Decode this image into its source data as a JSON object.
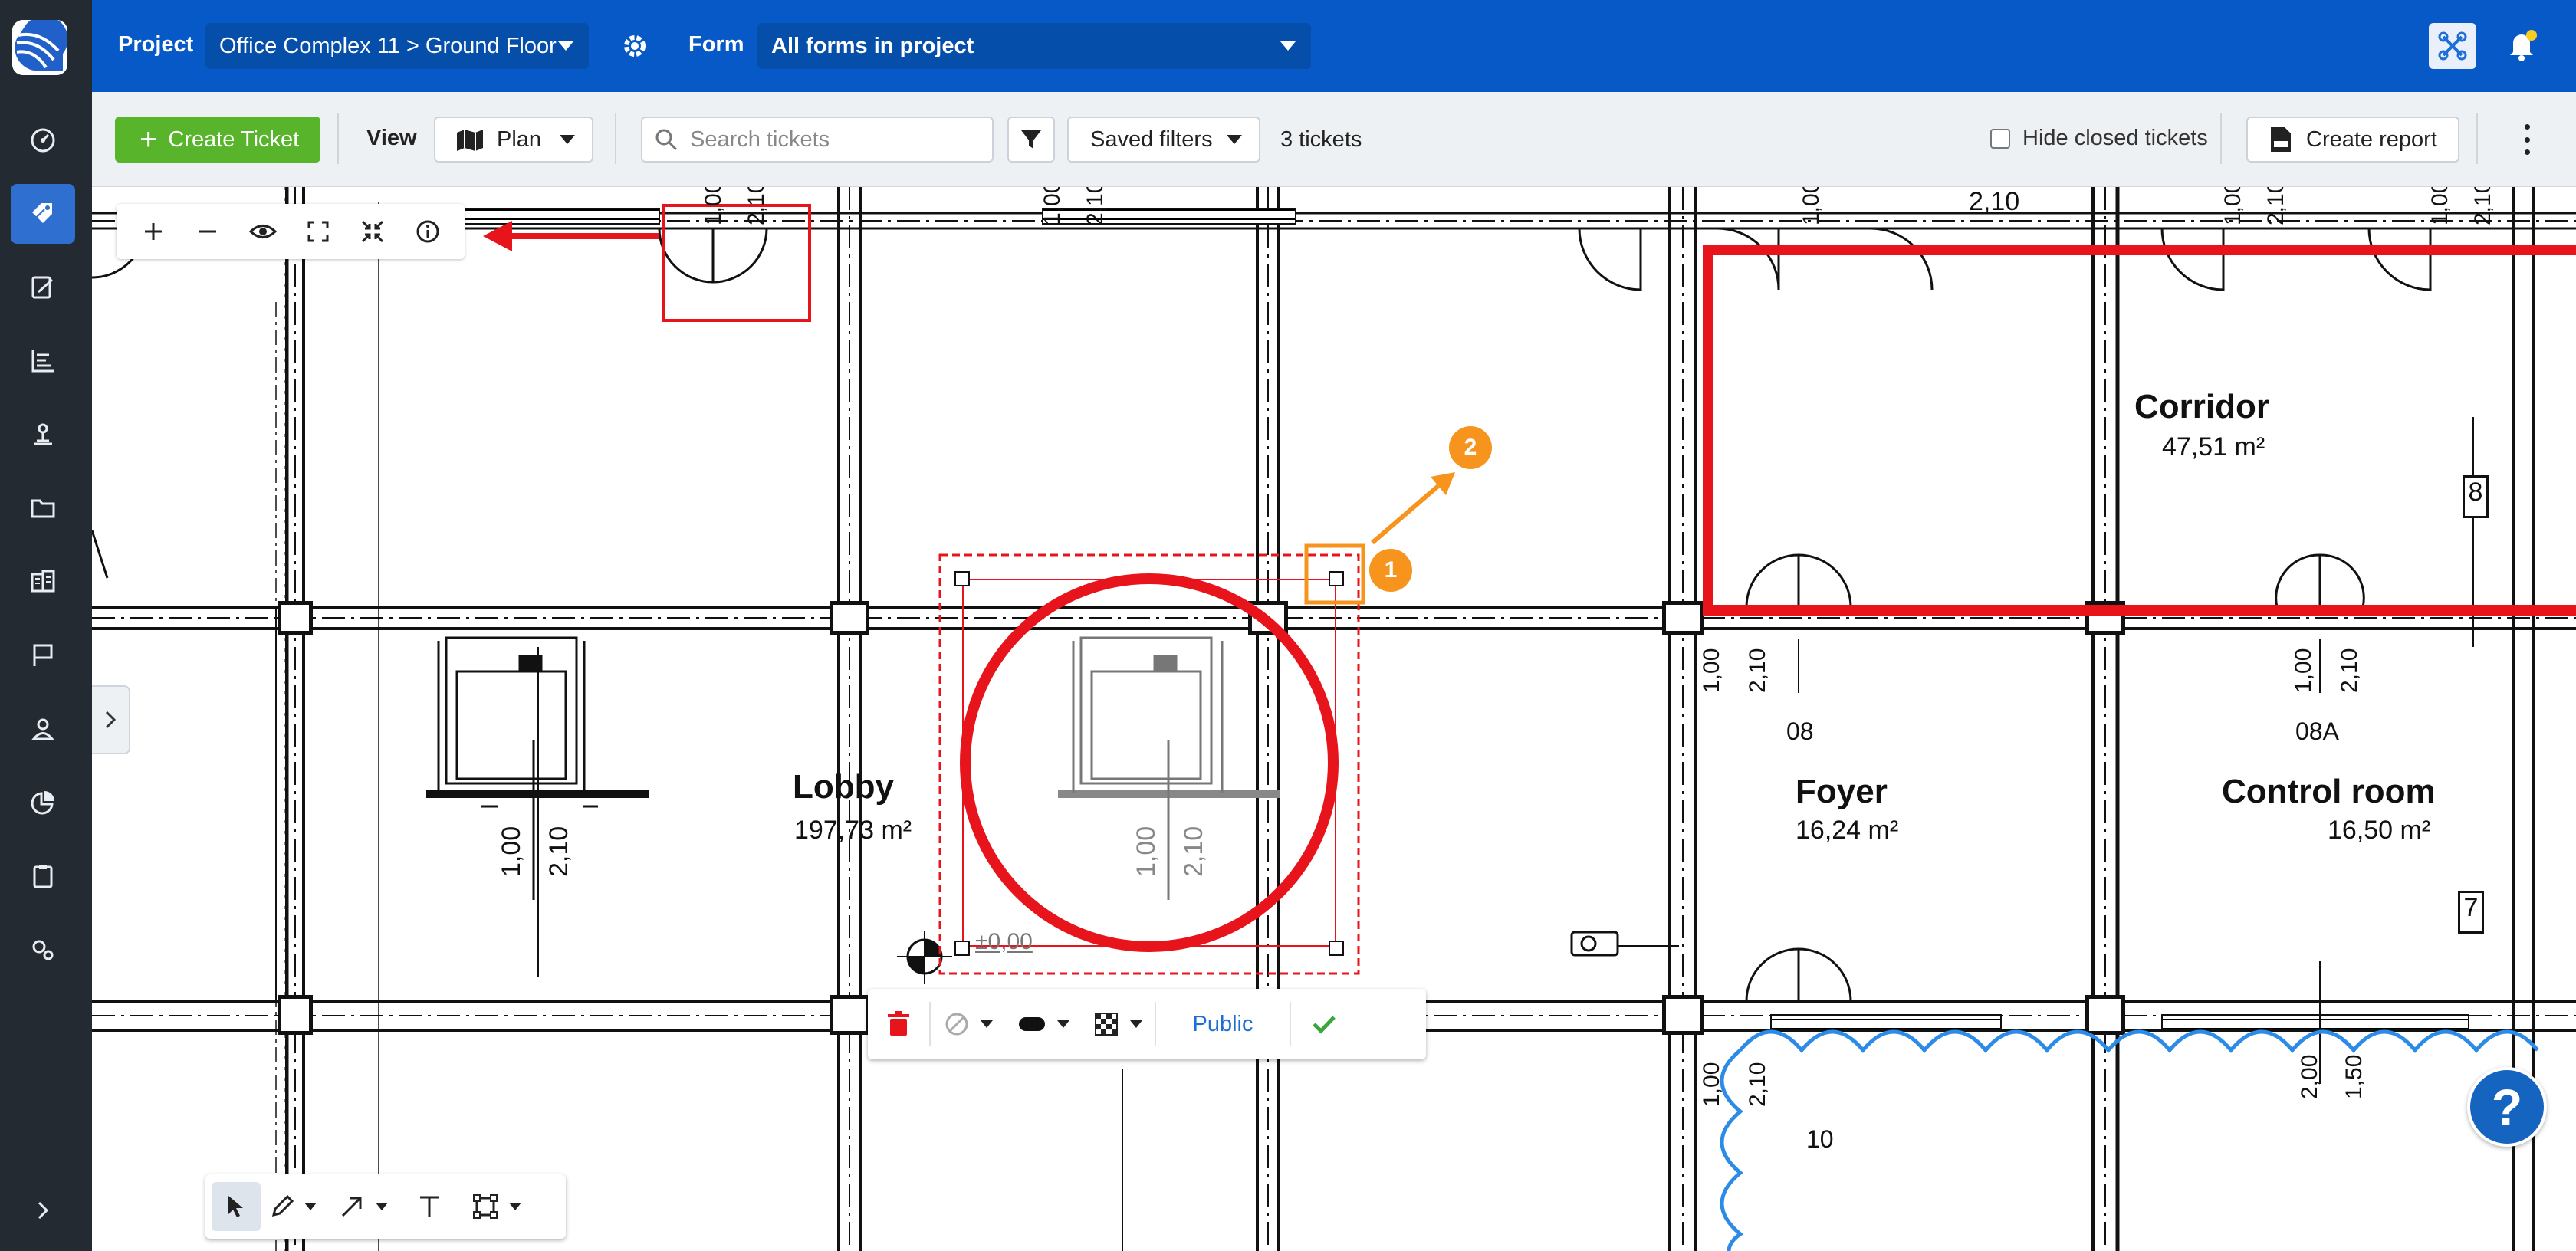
{
  "topbar": {
    "project_label": "Project",
    "project_value": "Office Complex 11 > Ground Floor",
    "form_label": "Form",
    "form_value": "All forms in project",
    "icons": [
      "settings-gear-icon",
      "apps-icon",
      "bell-icon"
    ]
  },
  "sidebar": {
    "items": [
      "dashboard-icon",
      "tickets-icon",
      "forms-icon",
      "charts-icon",
      "inspection-icon",
      "folder-icon",
      "documents-icon",
      "flag-icon",
      "user-icon",
      "reports-icon",
      "clipboard-icon",
      "settings-icon",
      "expand-icon"
    ],
    "active": "tickets-icon"
  },
  "toolbar": {
    "create_ticket": "Create Ticket",
    "view_label": "View",
    "view_value": "Plan",
    "search_placeholder": "Search tickets",
    "saved_filters": "Saved filters",
    "ticket_count": "3 tickets",
    "hide_closed": "Hide closed tickets",
    "create_report": "Create report"
  },
  "plan": {
    "rooms": [
      {
        "name": "Lobby",
        "area": "197,73 m²"
      },
      {
        "name": "Corridor",
        "area": "47,51 m²"
      },
      {
        "name": "Foyer",
        "area": "16,24 m²"
      },
      {
        "name": "Control room",
        "area": "16,50 m²"
      }
    ],
    "dimension_labels": {
      "d100": "1,00",
      "d210": "2,10",
      "d200": "2,00",
      "d150": "1,50",
      "door08": "08",
      "door08a": "08A",
      "door10": "10",
      "level": "±0,00",
      "tag8": "8",
      "tag7": "7"
    },
    "markers": [
      "1",
      "2"
    ]
  },
  "format_toolbar": {
    "visibility": "Public"
  },
  "help": "?",
  "colors": {
    "brand_blue": "#0759c7",
    "sidebar_dark": "#232a32",
    "create_green": "#58b42a",
    "markup_red": "#e8141b",
    "marker_orange": "#f7941d",
    "cloud_blue": "#2b8be6"
  }
}
